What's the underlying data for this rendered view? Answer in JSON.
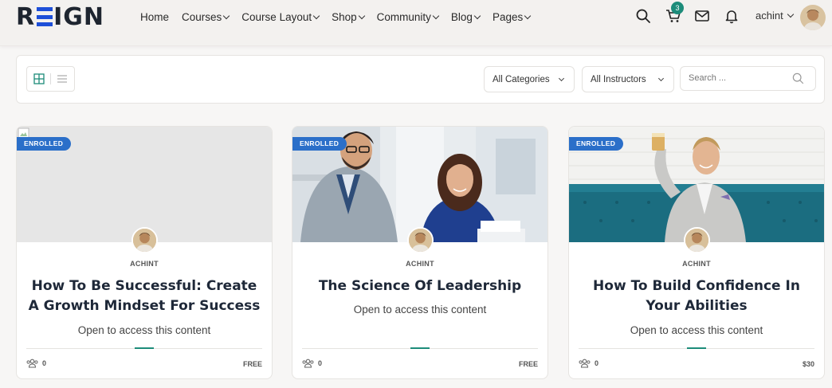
{
  "brand": {
    "logo_before": "R",
    "logo_after": "IGN",
    "accent": "#1e4fd8"
  },
  "nav": [
    {
      "label": "Home",
      "dropdown": false
    },
    {
      "label": "Courses",
      "dropdown": true
    },
    {
      "label": "Course Layout",
      "dropdown": true
    },
    {
      "label": "Shop",
      "dropdown": true
    },
    {
      "label": "Community",
      "dropdown": true
    },
    {
      "label": "Blog",
      "dropdown": true
    },
    {
      "label": "Pages",
      "dropdown": true
    }
  ],
  "header": {
    "icons": [
      "search-icon",
      "cart-icon",
      "mail-icon",
      "bell-icon"
    ],
    "cart_count": "3",
    "username": "achint"
  },
  "filters": {
    "category_selected": "All Categories",
    "instructor_selected": "All Instructors",
    "search_placeholder": "Search ...",
    "view_modes": [
      "grid-view-icon",
      "list-view-icon"
    ]
  },
  "courses": [
    {
      "badge": "ENROLLED",
      "author": "ACHINT",
      "title": "How To Be Successful: Create A Growth Mindset For Success",
      "subtitle": "Open to access this content",
      "students": "0",
      "price": "FREE",
      "image": "broken-image"
    },
    {
      "badge": "ENROLLED",
      "author": "ACHINT",
      "title": "The Science Of Leadership",
      "subtitle": "Open to access this content",
      "students": "0",
      "price": "FREE",
      "image": "office-meeting-photo"
    },
    {
      "badge": "ENROLLED",
      "author": "ACHINT",
      "title": "How To Build Confidence In Your Abilities",
      "subtitle": "Open to access this content",
      "students": "0",
      "price": "$30",
      "image": "toast-celebration-photo"
    }
  ],
  "colors": {
    "teal": "#1d8c7a",
    "badge_blue": "#2b6fc9",
    "title": "#1e2838"
  }
}
